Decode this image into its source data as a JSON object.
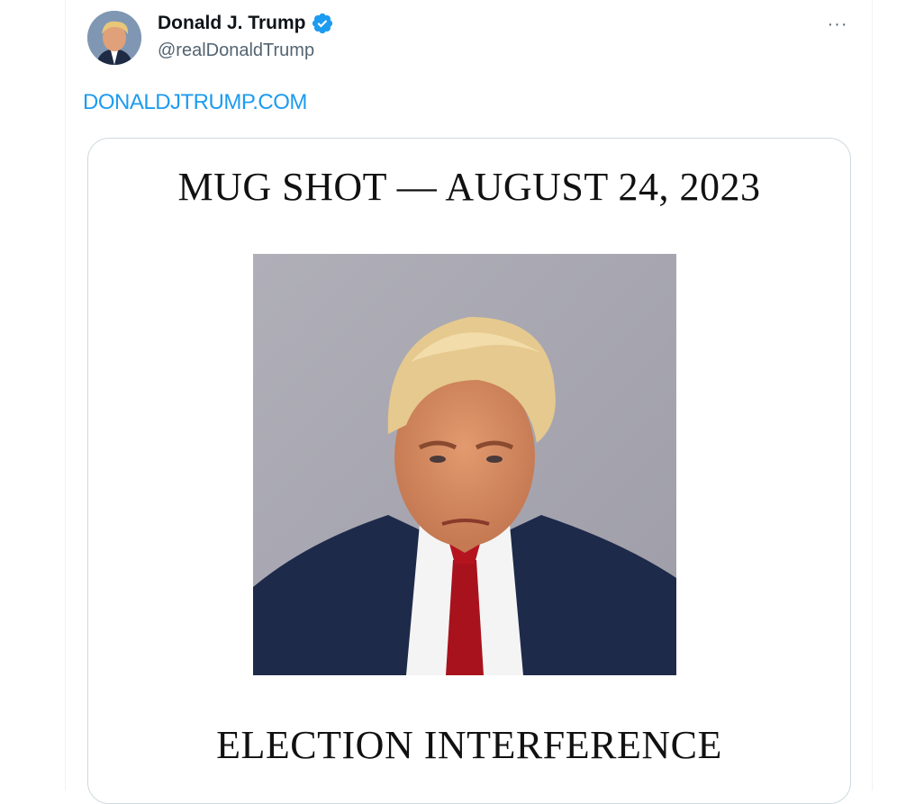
{
  "tweet": {
    "author": {
      "display_name": "Donald J. Trump",
      "handle": "@realDonaldTrump",
      "verified": true,
      "avatar_icon": "avatar-photo",
      "verified_icon": "verified-badge-icon"
    },
    "more_label": "···",
    "link_text": "DONALDJTRUMP.COM",
    "media": {
      "top_text": "MUG SHOT — AUGUST 24, 2023",
      "bottom_text": "ELECTION INTERFERENCE"
    }
  },
  "colors": {
    "link": "#1d9bf0",
    "verified": "#1d9bf0",
    "text_primary": "#0f1419",
    "text_secondary": "#536471",
    "border": "#cfd9de"
  }
}
